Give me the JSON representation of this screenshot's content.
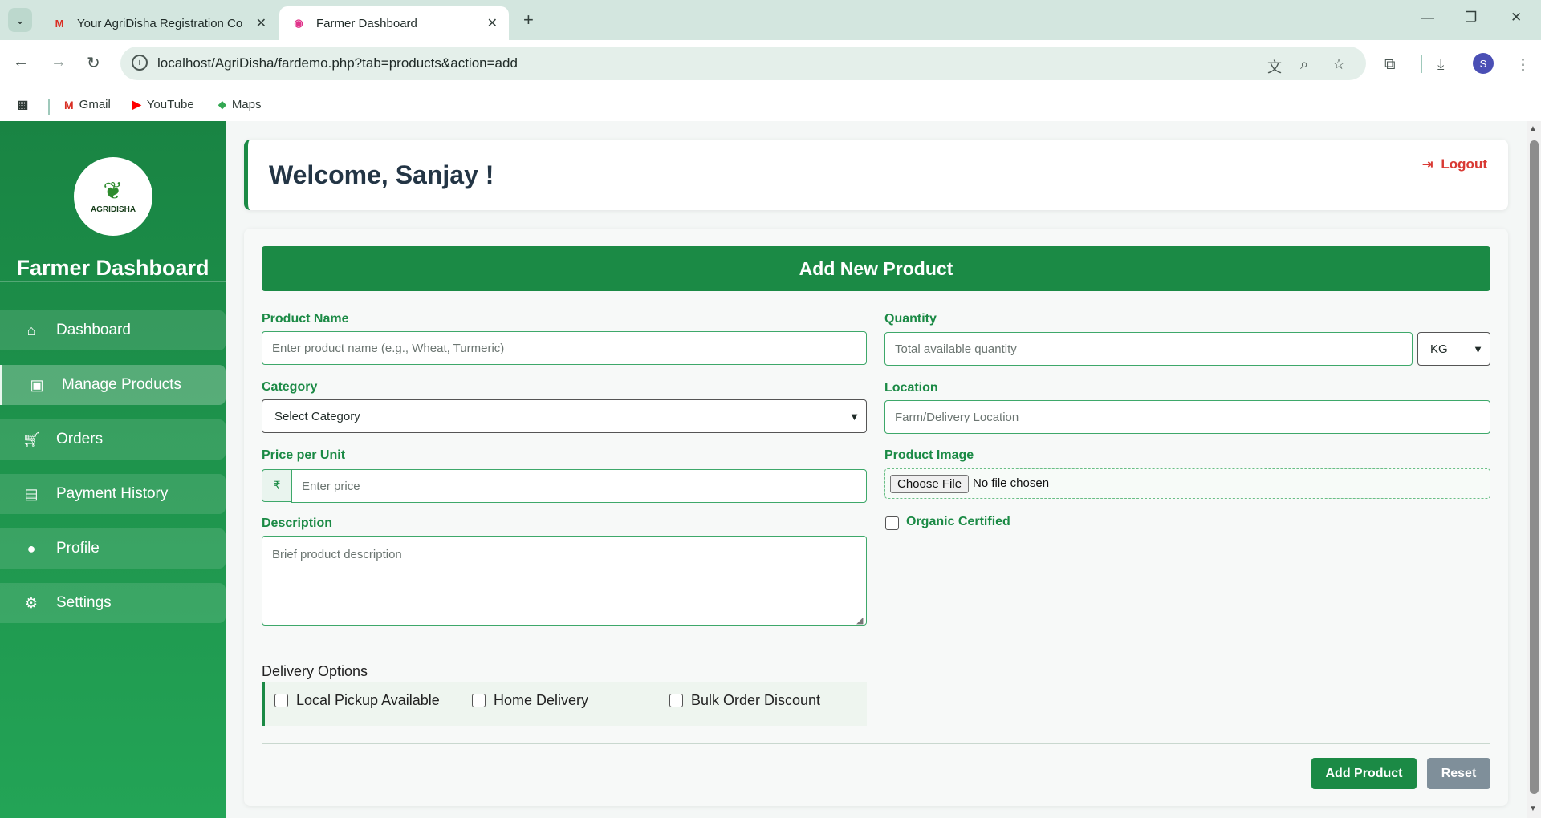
{
  "browser": {
    "tabs": [
      {
        "title": "Your AgriDisha Registration Co",
        "icon": "gmail-icon"
      },
      {
        "title": "Farmer Dashboard",
        "icon": "app-icon"
      }
    ],
    "url": "localhost/AgriDisha/fardemo.php?tab=products&action=add",
    "avatar_letter": "S",
    "bookmarks": [
      {
        "label": "Gmail",
        "icon": "gmail-icon"
      },
      {
        "label": "YouTube",
        "icon": "youtube-icon"
      },
      {
        "label": "Maps",
        "icon": "maps-icon"
      }
    ]
  },
  "sidebar": {
    "logo_text": "AGRIDISHA",
    "title": "Farmer Dashboard",
    "items": [
      {
        "label": "Dashboard",
        "icon": "home-icon"
      },
      {
        "label": "Manage Products",
        "icon": "box-icon",
        "active": true
      },
      {
        "label": "Orders",
        "icon": "cart-icon"
      },
      {
        "label": "Payment History",
        "icon": "money-icon"
      },
      {
        "label": "Profile",
        "icon": "user-icon"
      },
      {
        "label": "Settings",
        "icon": "gear-icon"
      }
    ]
  },
  "header": {
    "welcome": "Welcome, Sanjay !",
    "logout": "Logout"
  },
  "form": {
    "title": "Add New Product",
    "product_name": {
      "label": "Product Name",
      "placeholder": "Enter product name (e.g., Wheat, Turmeric)"
    },
    "quantity": {
      "label": "Quantity",
      "placeholder": "Total available quantity",
      "unit": "KG"
    },
    "category": {
      "label": "Category",
      "value": "Select Category"
    },
    "location": {
      "label": "Location",
      "placeholder": "Farm/Delivery Location"
    },
    "price": {
      "label": "Price per Unit",
      "currency": "₹",
      "placeholder": "Enter price"
    },
    "image": {
      "label": "Product Image",
      "button": "Choose File",
      "status": "No file chosen"
    },
    "organic": {
      "label": "Organic Certified",
      "checked": false
    },
    "description": {
      "label": "Description",
      "placeholder": "Brief product description"
    },
    "delivery": {
      "title": "Delivery Options",
      "options": [
        {
          "label": "Local Pickup Available",
          "checked": false
        },
        {
          "label": "Home Delivery",
          "checked": false
        },
        {
          "label": "Bulk Order Discount",
          "checked": false
        }
      ]
    },
    "submit": "Add Product",
    "reset": "Reset"
  },
  "colors": {
    "primary_green": "#1b8a45",
    "logout_red": "#d93a34",
    "reset_gray": "#7f8f9a"
  }
}
